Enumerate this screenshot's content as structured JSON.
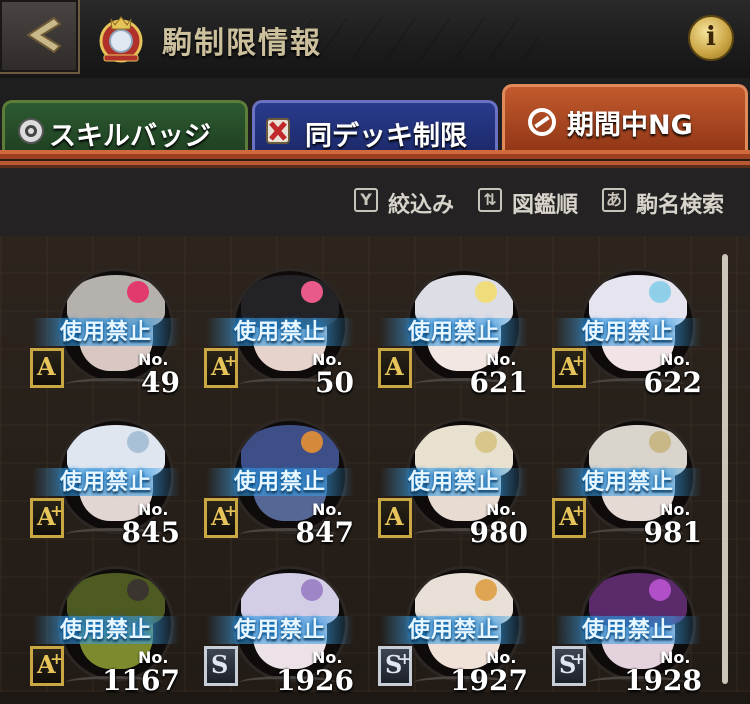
{
  "header": {
    "title": "駒制限情報",
    "back_icon": "back-arrow-icon",
    "info_label": "i"
  },
  "tabs": [
    {
      "label": "スキルバッジ",
      "icon": "badge-icon",
      "active": false,
      "color": "#2d5a30"
    },
    {
      "label": "同デッキ制限",
      "icon": "deck-restrict-icon",
      "active": false,
      "color": "#293b8c"
    },
    {
      "label": "期間中NG",
      "icon": "ban-icon",
      "active": true,
      "color": "#c25a2d"
    }
  ],
  "filters": [
    {
      "label": "絞込み",
      "icon_glyph": "Y",
      "icon": "filter-icon"
    },
    {
      "label": "図鑑順",
      "icon_glyph": "⇅",
      "icon": "sort-icon"
    },
    {
      "label": "駒名検索",
      "icon_glyph": "あ",
      "icon": "search-name-icon"
    }
  ],
  "no_prefix": "No.",
  "cards": [
    {
      "number": "49",
      "status": "使用禁止",
      "rank": "A",
      "plus": "",
      "hair": "#b5b1ad",
      "face": "#d9c8c2",
      "acc": "#e23a6c"
    },
    {
      "number": "50",
      "status": "使用禁止",
      "rank": "A",
      "plus": "+",
      "hair": "#232226",
      "face": "#e6d4cc",
      "acc": "#e85a8a"
    },
    {
      "number": "621",
      "status": "使用禁止",
      "rank": "A",
      "plus": "",
      "hair": "#dcdde5",
      "face": "#f2e7e2",
      "acc": "#f0dc7a"
    },
    {
      "number": "622",
      "status": "使用禁止",
      "rank": "A",
      "plus": "+",
      "hair": "#e6e4ef",
      "face": "#f2e4e6",
      "acc": "#8fd0e8"
    },
    {
      "number": "845",
      "status": "使用禁止",
      "rank": "A",
      "plus": "+",
      "hair": "#dfe6ef",
      "face": "#e2d6d2",
      "acc": "#a9c1d6"
    },
    {
      "number": "847",
      "status": "使用禁止",
      "rank": "A",
      "plus": "+",
      "hair": "#3e4f88",
      "face": "#556795",
      "acc": "#d48a3a"
    },
    {
      "number": "980",
      "status": "使用禁止",
      "rank": "A",
      "plus": "",
      "hair": "#e8e1d0",
      "face": "#e8dcd2",
      "acc": "#d8c68a"
    },
    {
      "number": "981",
      "status": "使用禁止",
      "rank": "A",
      "plus": "+",
      "hair": "#d9d4cc",
      "face": "#e6dad4",
      "acc": "#c9b887"
    },
    {
      "number": "1167",
      "status": "使用禁止",
      "rank": "A",
      "plus": "+",
      "hair": "#4d5a22",
      "face": "#7d8b2e",
      "acc": "#3b3530"
    },
    {
      "number": "1926",
      "status": "使用禁止",
      "rank": "S",
      "plus": "",
      "hair": "#d3cde6",
      "face": "#ece2e8",
      "acc": "#9d85c8"
    },
    {
      "number": "1927",
      "status": "使用禁止",
      "rank": "S",
      "plus": "+",
      "hair": "#e8dfd6",
      "face": "#f1e2d8",
      "acc": "#e0a552"
    },
    {
      "number": "1928",
      "status": "使用禁止",
      "rank": "S",
      "plus": "+",
      "hair": "#5a2a6a",
      "face": "#e4d2dc",
      "acc": "#b04fc8"
    }
  ]
}
